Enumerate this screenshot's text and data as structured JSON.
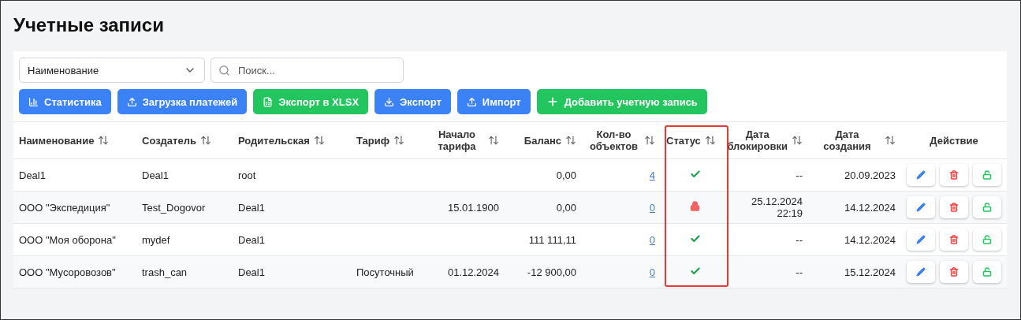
{
  "title": "Учетные записи",
  "filter": {
    "field": "Наименование",
    "search_placeholder": "Поиск..."
  },
  "toolbar": [
    {
      "label": "Статистика",
      "kind": "stats",
      "color": "#3b82f6"
    },
    {
      "label": "Загрузка платежей",
      "kind": "upload",
      "color": "#3b82f6"
    },
    {
      "label": "Экспорт в XLSX",
      "kind": "xlsx",
      "color": "#22c55e"
    },
    {
      "label": "Экспорт",
      "kind": "download",
      "color": "#3b82f6"
    },
    {
      "label": "Импорт",
      "kind": "upload",
      "color": "#3b82f6"
    },
    {
      "label": "Добавить учетную запись",
      "kind": "add",
      "color": "#22c55e"
    }
  ],
  "table": {
    "columns": [
      {
        "label": "Наименование",
        "sortable": true
      },
      {
        "label": "Создатель",
        "sortable": true
      },
      {
        "label": "Родительская",
        "sortable": true
      },
      {
        "label": "Тариф",
        "sortable": true
      },
      {
        "label": "Начало тарифа",
        "sortable": true
      },
      {
        "label": "Баланс",
        "sortable": true
      },
      {
        "label": "Кол-во объектов",
        "sortable": true
      },
      {
        "label": "Статус",
        "sortable": true,
        "highlighted": true
      },
      {
        "label": "Дата блокировки",
        "sortable": true
      },
      {
        "label": "Дата создания",
        "sortable": true
      },
      {
        "label": "Действие",
        "sortable": false
      }
    ],
    "rows": [
      {
        "name": "Deal1",
        "creator": "Deal1",
        "parent": "root",
        "balance": "0,00",
        "objects": "4",
        "kind": "active",
        "blocked_at": "--",
        "created": "20.09.2023"
      },
      {
        "name": "ООО \"Экспедиция\"",
        "creator": "Test_Dogovor",
        "parent": "Deal1",
        "tariff_start": "15.01.1900",
        "balance": "0,00",
        "objects": "0",
        "kind": "blocked",
        "blocked_at": "25.12.2024 22:19",
        "created": "14.12.2024"
      },
      {
        "name": "ООО \"Моя оборона\"",
        "creator": "mydef",
        "parent": "Deal1",
        "balance": "111 111,11",
        "objects": "0",
        "kind": "active",
        "blocked_at": "--",
        "created": "14.12.2024"
      },
      {
        "name": "ООО \"Мусоровозов\"",
        "creator": "trash_can",
        "parent": "Deal1",
        "tariff": "Посуточный",
        "tariff_start": "01.12.2024",
        "balance": "-12 900,00",
        "objects": "0",
        "kind": "active",
        "blocked_at": "--",
        "created": "15.12.2024"
      }
    ]
  }
}
